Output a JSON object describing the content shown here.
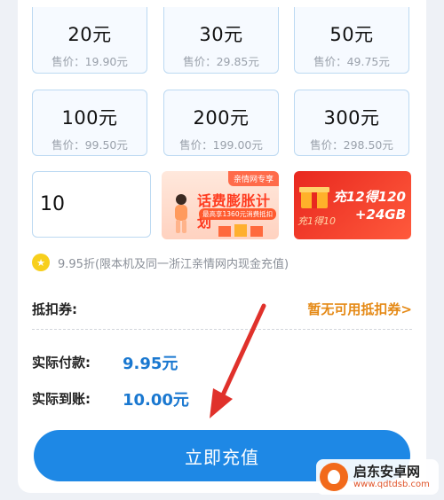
{
  "packages": [
    {
      "amount": "20元",
      "price": "售价：19.90元"
    },
    {
      "amount": "30元",
      "price": "售价：29.85元"
    },
    {
      "amount": "50元",
      "price": "售价：49.75元"
    },
    {
      "amount": "100元",
      "price": "售价：99.50元"
    },
    {
      "amount": "200元",
      "price": "售价：199.00元"
    },
    {
      "amount": "300元",
      "price": "售价：298.50元"
    }
  ],
  "custom_amount": {
    "value": "10"
  },
  "banners": {
    "promo1": {
      "tag": "亲情网专享",
      "title": "话费膨胀计划",
      "sub": "最高享1360元消费抵扣"
    },
    "promo2": {
      "title": "充12得120",
      "sub": "+24GB",
      "side": "充1得10"
    }
  },
  "discount_note": "9.95折(限本机及同一浙江亲情网内现金充值)",
  "coupon": {
    "label": "抵扣券:",
    "value": "暂无可用抵扣券>"
  },
  "summary": {
    "pay_label": "实际付款:",
    "pay_value": "9.95元",
    "receive_label": "实际到账:",
    "receive_value": "10.00元"
  },
  "cta_label": "立即充值",
  "watermark": {
    "title": "启东安卓网",
    "url": "www.qdtdsb.com"
  },
  "colors": {
    "accent": "#1e88e5",
    "link": "#e58a17",
    "annotation_arrow": "#e0312b"
  }
}
